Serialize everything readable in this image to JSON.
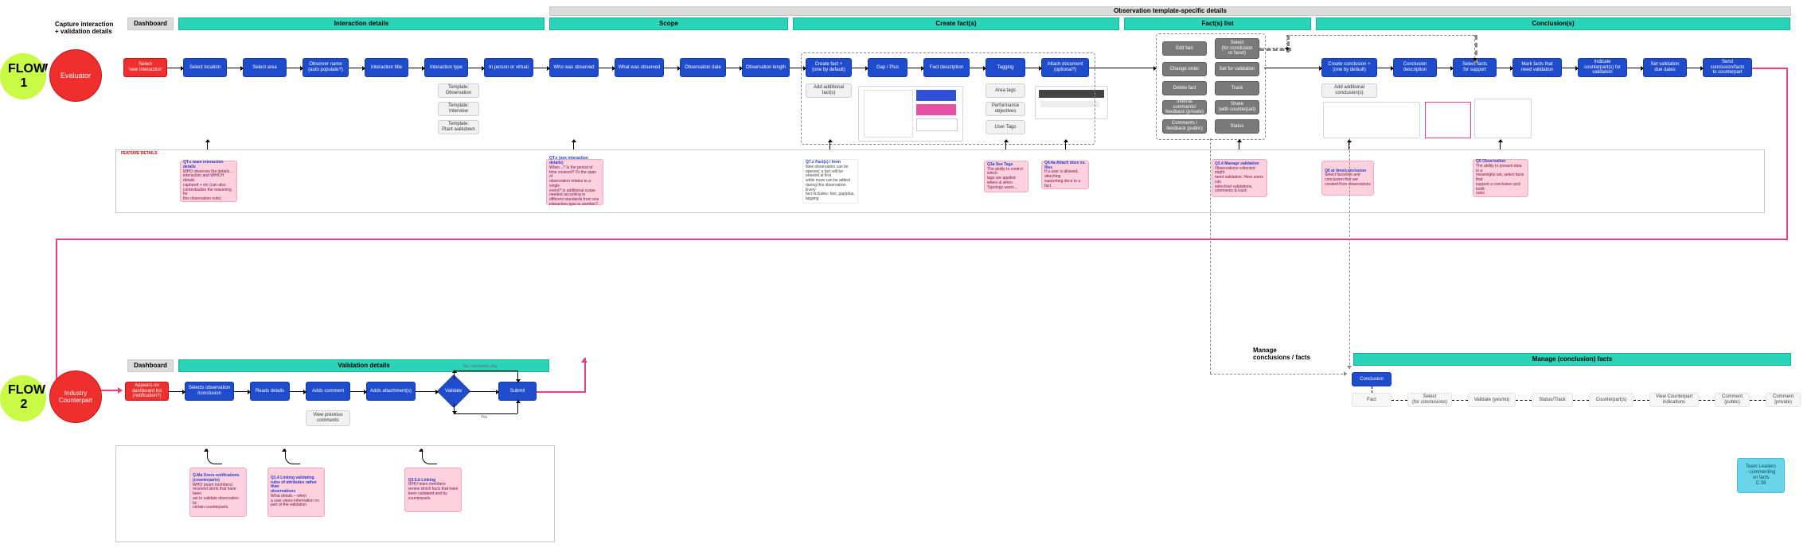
{
  "headers": {
    "capture": "Capture interaction\n+ validation details",
    "dashboard": "Dashboard",
    "interaction_details": "Interaction details",
    "observation_specific": "Observation template-specific details",
    "scope": "Scope",
    "create_facts": "Create fact(s)",
    "facts_list": "Fact(s) list",
    "conclusions": "Conclusion(s)",
    "dashboard2": "Dashboard",
    "validation_details": "Validation details",
    "manage_conclusions_facts": "Manage\nconclusions / facts",
    "manage_conclusion_facts": "Manage (conclusion) facts"
  },
  "flow1": {
    "label": "FLOW\n1",
    "role": "Evaluator",
    "start": "Select\n'new interaction'",
    "steps": {
      "loc": "Select location",
      "area": "Select area",
      "observer": "Observer name\n(auto populate?)",
      "title": "Interaction title",
      "type": "Interaction type",
      "mode": "In person or virtual",
      "who": "Who was observed",
      "what": "What was observed",
      "date": "Observation date",
      "length": "Observation length",
      "create_fact": "Create fact +\n(one by default)",
      "gap": "Gap / Plus",
      "desc": "Fact description",
      "tag": "Tagging",
      "attach": "Attach document\n(optional?)",
      "create_conc": "Create conclusion +\n(one by default)",
      "conc_desc": "Conclusion\ndescription",
      "sel_facts": "Select facts\nfor support",
      "mark": "Mark facts that\nneed validation",
      "indicate": "Indicate\ncounterpart(s) for\nvalidation",
      "due": "Set validation\ndue dates",
      "send": "Send\nconclusion/facts\nto counterpart"
    },
    "templates": {
      "obs": "Template:\nObservation",
      "int": "Template:\nInterview",
      "plant": "Template:\nPlant walkdown"
    },
    "sub": {
      "add_facts": "Add additional\nfact(s)",
      "area_tags": "Area tags",
      "perf": "Performance\nobjectives",
      "user_tags": "User Tags",
      "add_conc": "Add additional\nconclusion(s)"
    },
    "facts_grid": {
      "edit": "Edit fact",
      "select": "Select\n(for conclusion\nor facet)",
      "order": "Change order",
      "setval": "Set for validation",
      "del": "Delete fact",
      "track": "Track",
      "ifbp": "Internal comments/\nfeedback (private)",
      "share": "Share\n(with counterpart)",
      "cfbp": "Comments /\nfeedback (public)",
      "status": "Status"
    }
  },
  "notes": {
    "header": "FEATURE DETAILS",
    "names_title": "QT.x team interaction details",
    "names_body": "WHO observes the details…\ninteraction and WHICH details\ncaptured + etc (can also\ncontextualize the reasoning for\nthis observation note)",
    "scope_title": "QT.x (see interaction details)",
    "scope_body": "When...? Is the period of\ntime covered? Or the span of\nobservation relates to a single\nevent? Is additional scope\nneeded according to\ndifferent standards from one\ninteraction type to another?",
    "facts_title": "Q7.x Fact(s) / form",
    "facts_body": "New observation can be\nopened; a fact will be entered at first\nwhile more can be added\nduring this observation. Every\nfact includes: fact, gap/plus,\ntagging",
    "tags_title": "Q3a See Tags",
    "tags_body": "The ability to control which\ntags are applied where & when.\nTypology users…",
    "attach_title": "Q4.4a Attach docs vs. files",
    "attach_body": "If a user is allowed, attaching\nsupporting docs to a fact.",
    "factslist_title": "Q3.4 Manage validation",
    "factslist_body": "Observations collected might\nneed validation. Here users can\nselect/set validations,\ncomments & track",
    "conc1_title": "Q6 at time/conclusion",
    "conc1_body": "Select facts/link and\nconclusion that are\ncreated from observations",
    "conc2_title": "Q5 Observation",
    "conc2_body": "The ability to present data in a\nmeaningful set, select facts that\nsupport a conclusion and build\nrules"
  },
  "flow2": {
    "label": "FLOW\n2",
    "role": "Industry\nCounterpart",
    "start": "Appears on\ndashboard list\n(notification?)",
    "steps": {
      "select": "Selects observation\n/conclusion",
      "reads": "Reads details",
      "adds": "Adds comment",
      "attach": "Adds attachment(s)",
      "validate": "Validate",
      "submit": "Submit"
    },
    "sub": {
      "viewprev": "View previous\ncomments"
    },
    "dec": {
      "no": "No, comments only",
      "yes": "Yes"
    }
  },
  "notes2": {
    "a_title": "Q.Ma Users notifications\n(counterparts)",
    "a_body": "WHO (team members)\nreceived alerts that have been\nset to validate observation by\ncertain counterparts",
    "b_title": "Q1.4 Linking validating\nrules of attributes rather than\nobservations",
    "b_body": "What details – when\na user views information on\npart of the validation",
    "c_title": "Q3.5.b Linking",
    "c_body": "WHO team members\nreview which facts that have\nbeen validated and by\ncounterparts"
  },
  "manage": {
    "conc": "Conclusion",
    "fact": "Fact",
    "select": "Select\n(for conclusions)",
    "validate": "Validate (yes/no)",
    "status": "Status/Track",
    "counterparts": "Counterpart(s)",
    "view_cp": "View Counterpart\nindications",
    "comm_pub": "Comment\n(public)",
    "comm_priv": "Comment\n(private)"
  },
  "aside": {
    "tl": "Team Leaders\n- commenting\non facts\nC.38"
  }
}
